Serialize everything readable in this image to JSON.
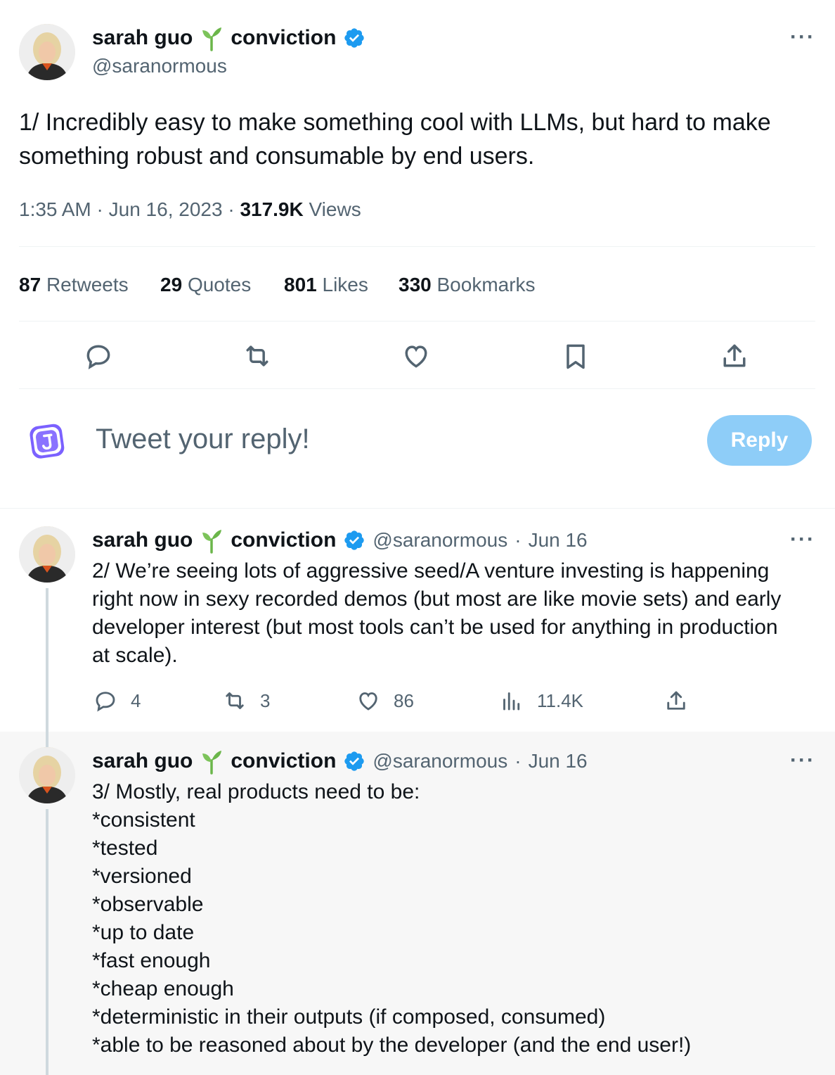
{
  "main_tweet": {
    "author_name": "sarah guo",
    "author_org": "conviction",
    "handle": "@saranormous",
    "more_label": "···",
    "text": "1/ Incredibly easy to make something cool with LLMs, but hard to make something robust and consumable by end users.",
    "time": "1:35 AM",
    "date": "Jun 16, 2023",
    "views_count": "317.9K",
    "views_label": "Views",
    "separator": "·",
    "stats": {
      "retweets_count": "87",
      "retweets_label": "Retweets",
      "quotes_count": "29",
      "quotes_label": "Quotes",
      "likes_count": "801",
      "likes_label": "Likes",
      "bookmarks_count": "330",
      "bookmarks_label": "Bookmarks"
    },
    "actions": [
      "reply-icon",
      "retweet-icon",
      "like-icon",
      "bookmark-icon",
      "share-icon"
    ]
  },
  "reply_box": {
    "placeholder": "Tweet your reply!",
    "button_label": "Reply"
  },
  "thread": [
    {
      "author_name": "sarah guo",
      "author_org": "conviction",
      "handle": "@saranormous",
      "date": "Jun 16",
      "separator": "·",
      "more_label": "···",
      "text": "2/ We’re seeing lots of aggressive seed/A venture investing is happening\nright now in sexy recorded demos (but most are like movie sets) and early\ndeveloper interest (but most tools can’t be used for anything in production\nat scale).",
      "replies": "4",
      "retweets": "3",
      "likes": "86",
      "views": "11.4K"
    },
    {
      "author_name": "sarah guo",
      "author_org": "conviction",
      "handle": "@saranormous",
      "date": "Jun 16",
      "separator": "·",
      "more_label": "···",
      "text": "3/ Mostly, real products need to be:\n*consistent\n*tested\n*versioned\n*observable\n*up to date\n*fast enough\n*cheap enough\n*deterministic in their outputs (if composed, consumed)\n*able to be reasoned about by the developer (and the end user!)"
    }
  ],
  "colors": {
    "primary_text": "#0f1419",
    "secondary_text": "#536471",
    "verified_blue": "#1d9bf0",
    "reply_button": "#8ecdf8",
    "sprout_green": "#6bb64a",
    "reply_logo_purple": "#7b61ff"
  }
}
